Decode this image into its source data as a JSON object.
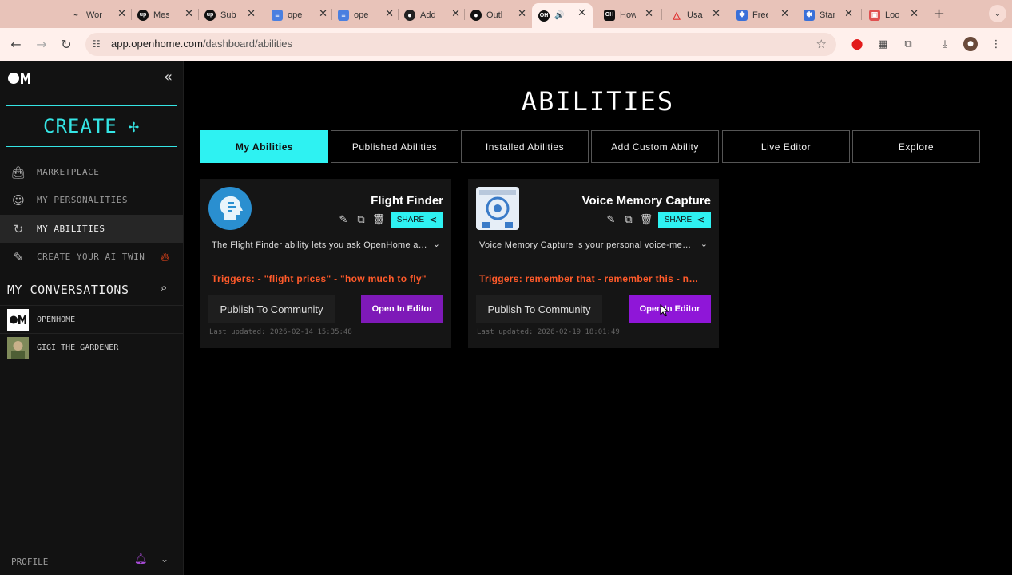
{
  "browser": {
    "tabs": [
      {
        "title": "Wor",
        "color": "#e8c3b9",
        "glyph": "~"
      },
      {
        "title": "Mes",
        "color": "#111111",
        "glyph": "up"
      },
      {
        "title": "Sub",
        "color": "#111111",
        "glyph": "up"
      },
      {
        "title": "ope",
        "color": "#4a7fe0",
        "glyph": "≡"
      },
      {
        "title": "ope",
        "color": "#4a7fe0",
        "glyph": "≡"
      },
      {
        "title": "Add",
        "color": "#222222",
        "glyph": "●"
      },
      {
        "title": "Outl",
        "color": "#111111",
        "glyph": "●"
      },
      {
        "title": "",
        "color": "#111111",
        "glyph": "●"
      },
      {
        "title": "How",
        "color": "#111111",
        "glyph": "●"
      },
      {
        "title": "Usa",
        "color": "#e03030",
        "glyph": "▲"
      },
      {
        "title": "Free",
        "color": "#3a70d8",
        "glyph": "✱"
      },
      {
        "title": "Star",
        "color": "#3a70d8",
        "glyph": "✱"
      },
      {
        "title": "Loo",
        "color": "#e05050",
        "glyph": "▣"
      }
    ],
    "url_domain": "app.openhome.com",
    "url_path": "/dashboard/abilities"
  },
  "sidebar": {
    "create_label": "CREATE",
    "items": [
      {
        "label": "MARKETPLACE",
        "icon": "bag-icon"
      },
      {
        "label": "MY PERSONALITIES",
        "icon": "smiley-icon"
      },
      {
        "label": "MY ABILITIES",
        "icon": "loop-icon"
      },
      {
        "label": "CREATE YOUR AI TWIN",
        "icon": "wand-icon"
      }
    ],
    "conversations_title": "MY CONVERSATIONS",
    "conversations": [
      {
        "label": "OPENHOME"
      },
      {
        "label": "GIGI THE GARDENER"
      }
    ],
    "profile_label": "PROFILE"
  },
  "main": {
    "title": "ABILITIES",
    "tabs": [
      {
        "label": "My Abilities"
      },
      {
        "label": "Published Abilities"
      },
      {
        "label": "Installed Abilities"
      },
      {
        "label": "Add Custom Ability"
      },
      {
        "label": "Live Editor"
      },
      {
        "label": "Explore"
      }
    ],
    "cards": [
      {
        "name": "Flight Finder",
        "share_label": "SHARE",
        "description": "The Flight Finder ability lets you ask OpenHome about flight prices and more",
        "triggers": "Triggers: - \"flight prices\" - \"how much to fly\"",
        "publish_label": "Publish To Community",
        "editor_label": "Open In Editor",
        "updated": "Last updated: 2026-02-14 15:35:48"
      },
      {
        "name": "Voice Memory Capture",
        "share_label": "SHARE",
        "description": "Voice Memory Capture is your personal voice-memory assistant",
        "triggers": "Triggers: remember that - remember this - note that",
        "publish_label": "Publish To Community",
        "editor_label": "Open In Editor",
        "updated": "Last updated: 2026-02-19 18:01:49"
      }
    ]
  },
  "colors": {
    "accent_cyan": "#2ef2f2",
    "editor_purple": "#7e19b8",
    "trigger_orange": "#ff5a2a"
  }
}
